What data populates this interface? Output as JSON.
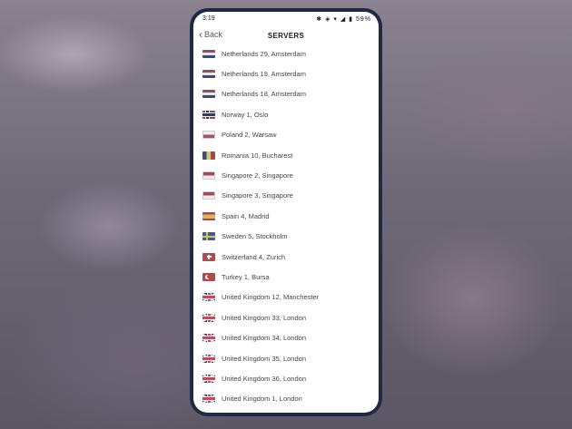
{
  "status_bar": {
    "time": "3:19",
    "icons": "✱ ◈ ▾ ◢ ▮ 59%"
  },
  "header": {
    "back_label": "Back",
    "title": "SERVERS"
  },
  "servers": [
    {
      "name": "Netherlands 29, Amsterdam",
      "flag": "nl"
    },
    {
      "name": "Netherlands 19, Amsterdam",
      "flag": "nl"
    },
    {
      "name": "Netherlands 18, Amsterdam",
      "flag": "nl"
    },
    {
      "name": "Norway 1, Oslo",
      "flag": "no"
    },
    {
      "name": "Poland 2, Warsaw",
      "flag": "pl"
    },
    {
      "name": "Romania 10, Bucharest",
      "flag": "ro"
    },
    {
      "name": "Singapore 2, Singapore",
      "flag": "sg"
    },
    {
      "name": "Singapore 3, Singapore",
      "flag": "sg"
    },
    {
      "name": "Spain 4, Madrid",
      "flag": "es"
    },
    {
      "name": "Sweden 5, Stockholm",
      "flag": "se"
    },
    {
      "name": "Switzerland 4, Zurich",
      "flag": "ch"
    },
    {
      "name": "Turkey 1, Bursa",
      "flag": "tr"
    },
    {
      "name": "United Kingdom 12, Manchester",
      "flag": "gb"
    },
    {
      "name": "United Kingdom 33, London",
      "flag": "gb"
    },
    {
      "name": "United Kingdom 34, London",
      "flag": "gb"
    },
    {
      "name": "United Kingdom 35, London",
      "flag": "gb"
    },
    {
      "name": "United Kingdom 36, London",
      "flag": "gb"
    },
    {
      "name": "United Kingdom 1, London",
      "flag": "gb"
    }
  ]
}
